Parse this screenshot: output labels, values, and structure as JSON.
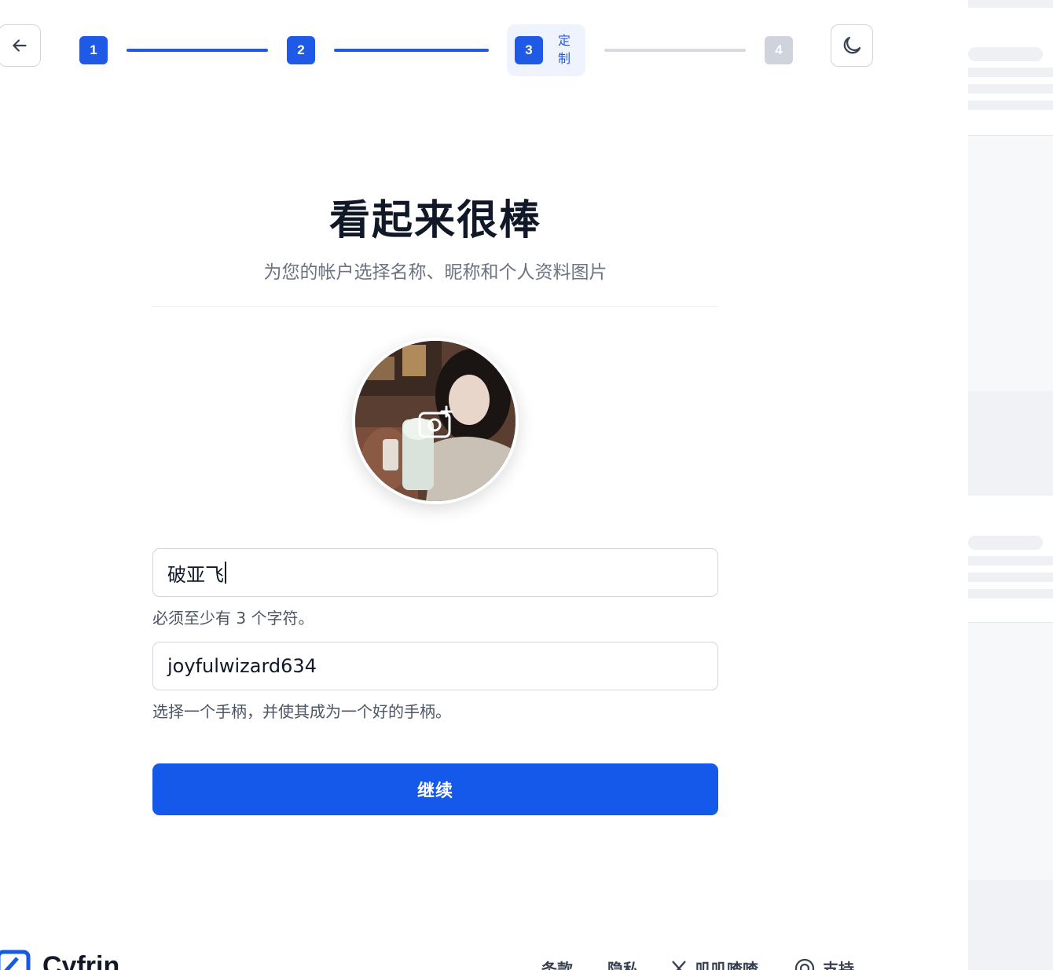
{
  "stepper": {
    "steps": [
      {
        "number": "1",
        "state": "done"
      },
      {
        "number": "2",
        "state": "done"
      },
      {
        "number": "3",
        "state": "active",
        "label": "定制"
      },
      {
        "number": "4",
        "state": "todo"
      }
    ]
  },
  "icons": {
    "back": "arrow-left-icon",
    "theme": "moon-icon",
    "avatar_upload": "camera-plus-icon",
    "x": "x-logo-icon",
    "support": "lifebuoy-icon"
  },
  "header": {
    "title": "看起来很棒",
    "subtitle": "为您的帐户选择名称、昵称和个人资料图片"
  },
  "form": {
    "name_value": "破亚飞",
    "name_hint": "必须至少有 3 个字符。",
    "handle_value": "joyfulwizard634",
    "handle_hint": "选择一个手柄，并使其成为一个好的手柄。",
    "continue_label": "继续"
  },
  "footer": {
    "brand": "Cyfrin",
    "links": [
      "条款",
      "隐私",
      "叽叽喳喳",
      "支持"
    ]
  },
  "colors": {
    "primary": "#1559ea",
    "step_done": "#1f5ae6",
    "step_todo": "#cfd3db",
    "active_step_bg": "#eef3fd"
  }
}
